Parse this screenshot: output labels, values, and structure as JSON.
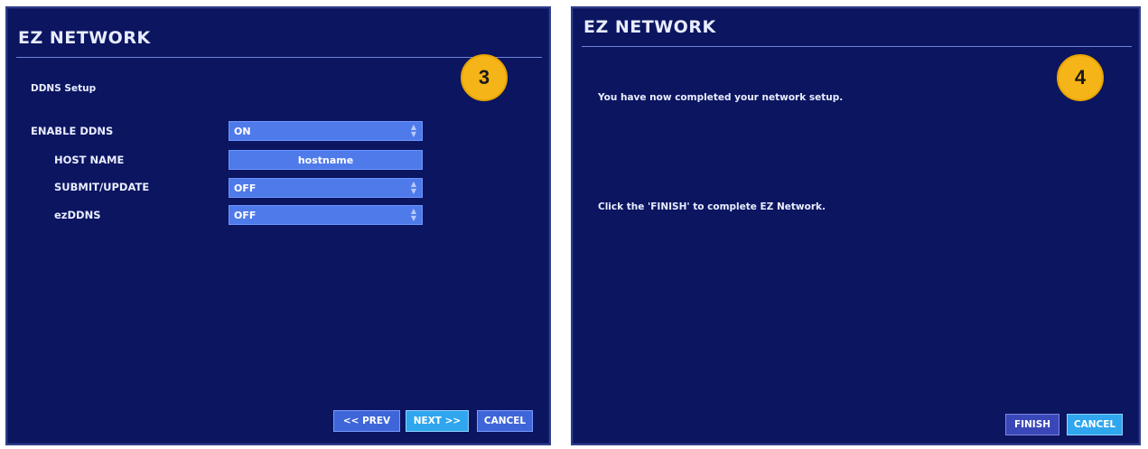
{
  "left": {
    "title": "EZ NETWORK",
    "step": "3",
    "section": "DDNS Setup",
    "fields": [
      {
        "label": "ENABLE DDNS",
        "value": "ON"
      },
      {
        "label": "HOST NAME",
        "value": "hostname"
      },
      {
        "label": "SUBMIT/UPDATE",
        "value": "OFF"
      },
      {
        "label": "ezDDNS",
        "value": "OFF"
      }
    ],
    "buttons": {
      "prev": "<< PREV",
      "next": "NEXT >>",
      "cancel": "CANCEL"
    }
  },
  "right": {
    "title": "EZ NETWORK",
    "step": "4",
    "message1": "You have now completed your network setup.",
    "message2": "Click the 'FINISH' to complete EZ Network.",
    "buttons": {
      "finish": "FINISH",
      "cancel": "CANCEL"
    }
  },
  "colors": {
    "panel_bg": "#0b1560",
    "field_bg": "#4f7aea",
    "badge": "#f5b418",
    "accent_button": "#2fa6ee"
  }
}
